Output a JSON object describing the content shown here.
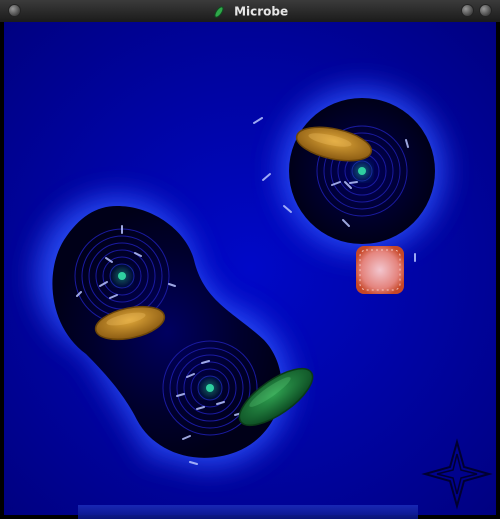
{
  "window": {
    "title": "Microbe"
  },
  "colors": {
    "background_blue": "#0000a8",
    "glow_blue": "#2e4dff",
    "cell_core": "#000018",
    "bacterium_orange": "#b8862a",
    "bacterium_green": "#1f7a3a",
    "virus_pink": "#f4a0a0"
  },
  "icons": {
    "app_icon": "green-bacterium-icon",
    "compass": "four-point-star-icon"
  }
}
